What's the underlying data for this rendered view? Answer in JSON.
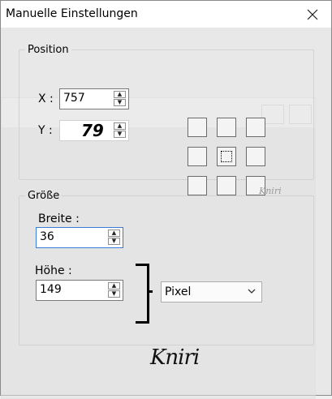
{
  "window": {
    "title": "Manuelle Einstellungen"
  },
  "position": {
    "legend": "Position",
    "x_label": "X :",
    "x_value": "757",
    "y_label": "Y :",
    "y_value": "79"
  },
  "size": {
    "legend": "Größe",
    "width_label": "Breite :",
    "width_value": "36",
    "height_label": "Höhe :",
    "height_value": "149",
    "unit_selected": "Pixel"
  },
  "anchor_grid": {
    "selected": "middle-center"
  },
  "watermark_small": "Kniri",
  "logo_text": "Kniri"
}
